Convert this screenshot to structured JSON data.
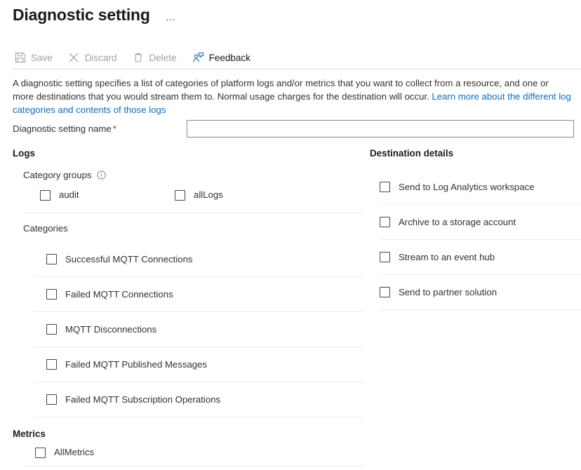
{
  "header": {
    "title": "Diagnostic setting",
    "more_label": "…"
  },
  "toolbar": {
    "save_label": "Save",
    "discard_label": "Discard",
    "delete_label": "Delete",
    "feedback_label": "Feedback"
  },
  "description": {
    "text": "A diagnostic setting specifies a list of categories of platform logs and/or metrics that you want to collect from a resource, and one or more destinations that you would stream them to. Normal usage charges for the destination will occur. ",
    "link_text": "Learn more about the different log categories and contents of those logs"
  },
  "name_field": {
    "label": "Diagnostic setting name",
    "required_marker": "*",
    "value": "",
    "placeholder": ""
  },
  "logs": {
    "heading": "Logs",
    "category_groups_label": "Category groups",
    "info_icon": "info-icon",
    "groups": [
      {
        "label": "audit",
        "checked": false
      },
      {
        "label": "allLogs",
        "checked": false
      }
    ],
    "categories_label": "Categories",
    "categories": [
      {
        "label": "Successful MQTT Connections",
        "checked": false
      },
      {
        "label": "Failed MQTT Connections",
        "checked": false
      },
      {
        "label": "MQTT Disconnections",
        "checked": false
      },
      {
        "label": "Failed MQTT Published Messages",
        "checked": false
      },
      {
        "label": "Failed MQTT Subscription Operations",
        "checked": false
      }
    ]
  },
  "metrics": {
    "heading": "Metrics",
    "items": [
      {
        "label": "AllMetrics",
        "checked": false
      }
    ]
  },
  "destination": {
    "heading": "Destination details",
    "options": [
      {
        "label": "Send to Log Analytics workspace",
        "checked": false
      },
      {
        "label": "Archive to a storage account",
        "checked": false
      },
      {
        "label": "Stream to an event hub",
        "checked": false
      },
      {
        "label": "Send to partner solution",
        "checked": false
      }
    ]
  },
  "colors": {
    "link": "#0f6cbd",
    "required": "#a4262c",
    "accent": "#0078d4",
    "disabled_text": "#a19f9d"
  }
}
